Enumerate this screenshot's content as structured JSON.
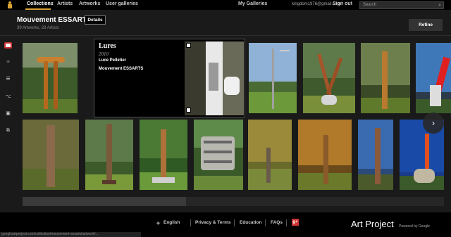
{
  "nav": {
    "collections": "Collections",
    "artists": "Artists",
    "artworks": "Artworks",
    "user_galleries": "User galleries",
    "my_galleries": "My Galleries",
    "email": "kingdom1976@gmail.com",
    "sign_out": "Sign out",
    "search_placeholder": "Search"
  },
  "collection": {
    "title": "Mouvement ESSARTS",
    "details_label": "Details",
    "subtitle": "39 Artworks, 28 Artists",
    "refine_label": "Refine"
  },
  "popup": {
    "title": "Lures",
    "year": "2010",
    "artist": "Luce Pelletier",
    "collection": "Mouvement ESSARTS"
  },
  "footer": {
    "language": "English",
    "privacy": "Privacy & Terms",
    "education": "Education",
    "faqs": "FAQs",
    "brand": "Art Project",
    "powered": "Powered by Google"
  },
  "status_url": "googleartproject.com/collection/mouvement-essarts/artwork/..."
}
